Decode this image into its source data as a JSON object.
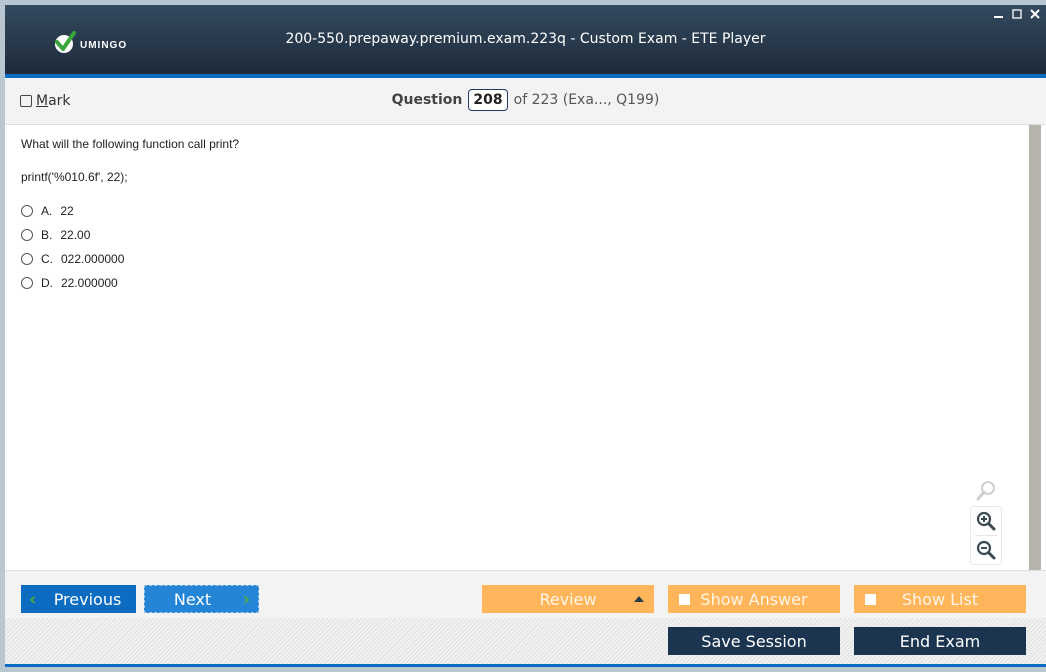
{
  "app": {
    "logo_text": "UMINGO",
    "title": "200-550.prepaway.premium.exam.223q - Custom Exam - ETE Player",
    "window_controls": [
      "minimize-icon",
      "maximize-icon",
      "close-icon"
    ]
  },
  "question_bar": {
    "mark_label_prefix": "M",
    "mark_label_rest": "ark",
    "question_label": "Question",
    "question_number": "208",
    "question_of": "of 223 (Exa..., Q199)"
  },
  "question": {
    "text": "What will the following function call print?",
    "code": "printf('%010.6f', 22);",
    "options": [
      {
        "letter": "A.",
        "text": "22"
      },
      {
        "letter": "B.",
        "text": "22.00"
      },
      {
        "letter": "C.",
        "text": "022.000000"
      },
      {
        "letter": "D.",
        "text": "22.000000"
      }
    ]
  },
  "zoom_tools": [
    "search-icon",
    "zoom-in-icon",
    "zoom-out-icon"
  ],
  "navigation": {
    "previous_label": "Previous",
    "next_label": "Next",
    "review_label": "Review",
    "show_answer_label": "Show Answer",
    "show_list_label": "Show List"
  },
  "footer": {
    "save_session_label": "Save Session",
    "end_exam_label": "End Exam"
  },
  "colors": {
    "title_bar": "#1d2b3b",
    "accent_blue": "#0b6cc1",
    "orange": "#ffb55a",
    "dark_navy": "#1b3450"
  }
}
